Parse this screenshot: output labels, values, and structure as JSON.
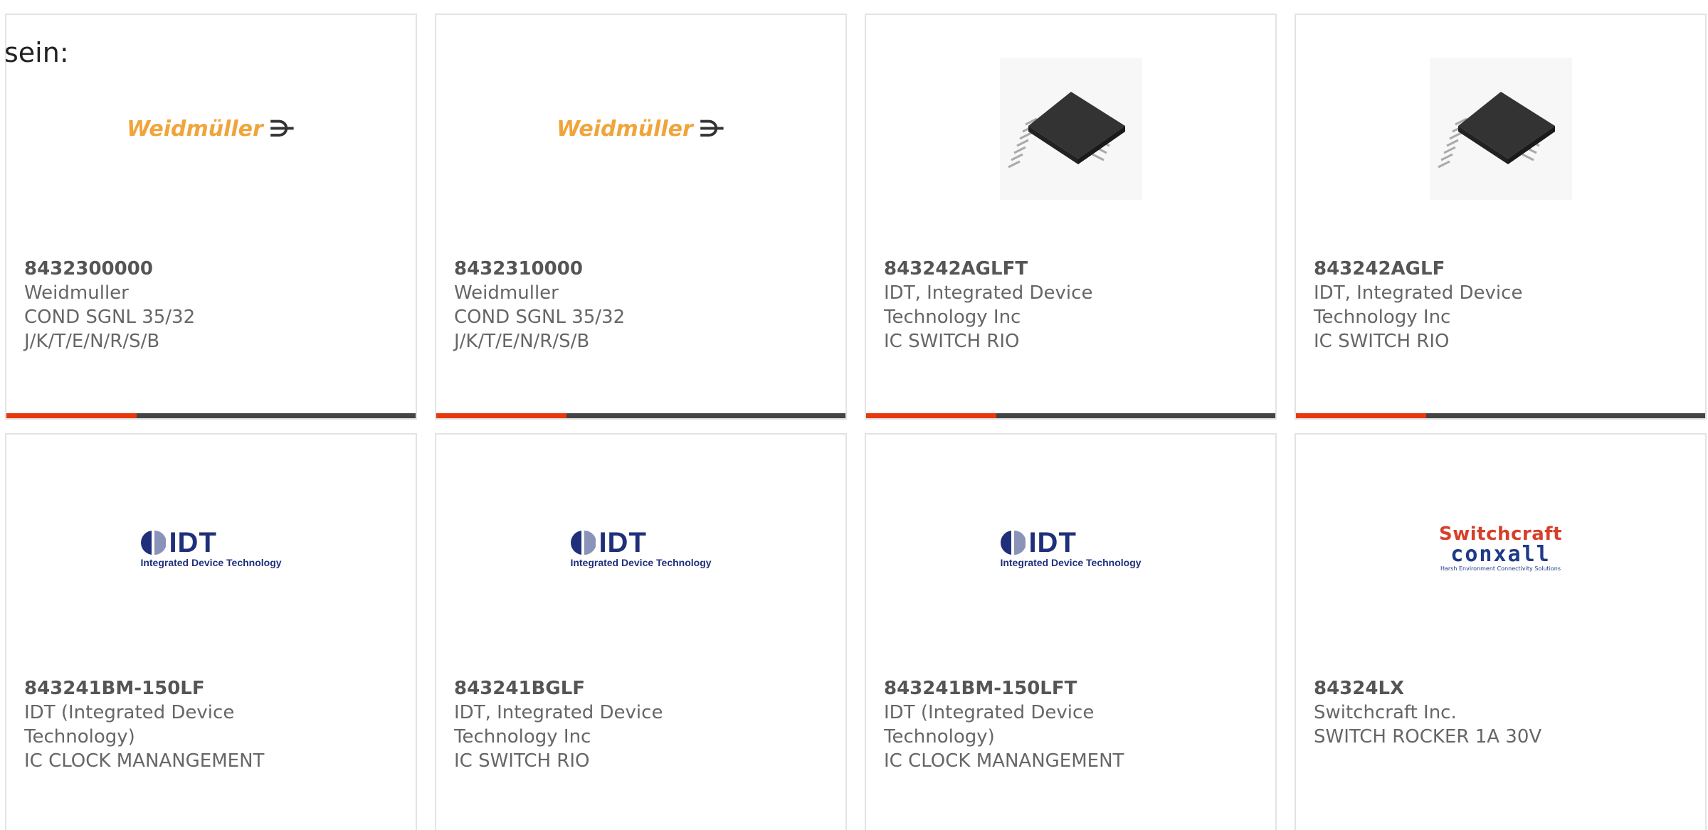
{
  "intro_text": "sein:",
  "cards": [
    {
      "part_number": "8432300000",
      "manufacturer": "Weidmuller",
      "description_line1": "COND SGNL 35/32",
      "description_line2": "J/K/T/E/N/R/S/B",
      "logo": "Weidmüller",
      "logo_mark": "⋺",
      "image_type": "weidmuller-logo"
    },
    {
      "part_number": "8432310000",
      "manufacturer": "Weidmuller",
      "description_line1": "COND SGNL 35/32",
      "description_line2": "J/K/T/E/N/R/S/B",
      "logo": "Weidmüller",
      "logo_mark": "⋺",
      "image_type": "weidmuller-logo"
    },
    {
      "part_number": "843242AGLFT",
      "manufacturer_line1": "IDT, Integrated Device",
      "manufacturer_line2": "Technology Inc",
      "description_line1": "IC SWITCH RIO",
      "image_type": "chip-photo"
    },
    {
      "part_number": "843242AGLF",
      "manufacturer_line1": "IDT, Integrated Device",
      "manufacturer_line2": "Technology Inc",
      "description_line1": "IC SWITCH RIO",
      "image_type": "chip-photo"
    },
    {
      "part_number": "843241BM-150LF",
      "manufacturer_line1": "IDT (Integrated Device",
      "manufacturer_line2": "Technology)",
      "description_line1": "IC CLOCK MANANGEMENT",
      "logo_big": "IDT",
      "logo_small": "Integrated Device Technology",
      "image_type": "idt-logo"
    },
    {
      "part_number": "843241BGLF",
      "manufacturer_line1": "IDT, Integrated Device",
      "manufacturer_line2": "Technology Inc",
      "description_line1": "IC SWITCH RIO",
      "logo_big": "IDT",
      "logo_small": "Integrated Device Technology",
      "image_type": "idt-logo"
    },
    {
      "part_number": "843241BM-150LFT",
      "manufacturer_line1": "IDT (Integrated Device",
      "manufacturer_line2": "Technology)",
      "description_line1": "IC CLOCK MANANGEMENT",
      "logo_big": "IDT",
      "logo_small": "Integrated Device Technology",
      "image_type": "idt-logo"
    },
    {
      "part_number": "84324LX",
      "manufacturer_line1": "Switchcraft Inc.",
      "description_line1": "SWITCH ROCKER 1A 30V",
      "logo_top": "Switchcraft",
      "logo_mid": "conxall",
      "logo_tag": "Harsh Environment Connectivity Solutions",
      "image_type": "switchcraft-logo"
    }
  ],
  "colors": {
    "accent": "#e8380d",
    "bar": "#444444",
    "card_border": "#e3e3e3",
    "text": "#666666",
    "weidmuller_orange": "#f0a43a",
    "idt_blue": "#1f2f7a",
    "switchcraft_red": "#d6402a"
  }
}
